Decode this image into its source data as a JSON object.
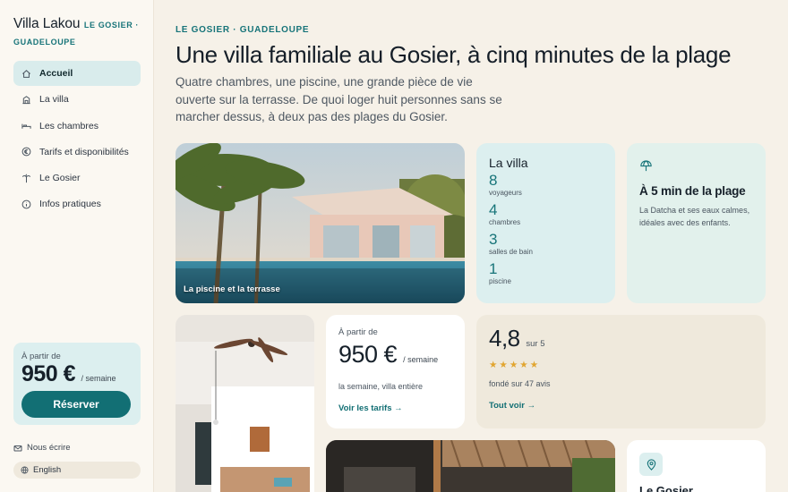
{
  "brand": {
    "name": "Villa Lakou",
    "location": "LE GOSIER · GUADELOUPE"
  },
  "nav": [
    {
      "label": "Accueil",
      "icon": "home-icon",
      "active": true
    },
    {
      "label": "La villa",
      "icon": "building-icon"
    },
    {
      "label": "Les chambres",
      "icon": "bed-icon"
    },
    {
      "label": "Tarifs et disponibilités",
      "icon": "euro-icon"
    },
    {
      "label": "Le Gosier",
      "icon": "palm-icon"
    },
    {
      "label": "Infos pratiques",
      "icon": "info-icon"
    }
  ],
  "booking": {
    "from_label": "À partir de",
    "price": "950 €",
    "unit": "/ semaine",
    "button": "Réserver"
  },
  "footer_links": {
    "contact": "Nous écrire",
    "language": "English"
  },
  "hero": {
    "kicker": "LE GOSIER · GUADELOUPE",
    "title": "Une villa familiale au Gosier, à cinq minutes de la plage",
    "lead": "Quatre chambres, une piscine, une grande pièce de vie ouverte sur la terrasse. De quoi loger huit personnes sans se marcher dessus, à deux pas des plages du Gosier."
  },
  "pool_photo": {
    "caption": "La piscine et la terrasse"
  },
  "stats": {
    "title": "La villa",
    "items": [
      {
        "value": "8",
        "label": "voyageurs"
      },
      {
        "value": "4",
        "label": "chambres"
      },
      {
        "value": "3",
        "label": "salles de bain"
      },
      {
        "value": "1",
        "label": "piscine"
      }
    ]
  },
  "beach": {
    "icon": "umbrella-icon",
    "title": "À 5 min de la plage",
    "text": "La Datcha et ses eaux calmes, idéales avec des enfants."
  },
  "price_card": {
    "from_label": "À partir de",
    "price": "950 €",
    "unit": "/ semaine",
    "note": "la semaine, villa entière",
    "link": "Voir les tarifs →"
  },
  "rating": {
    "score": "4,8",
    "out_of": "sur 5",
    "stars": 5,
    "note": "fondé sur 47 avis",
    "link": "Tout voir →"
  },
  "gosier_card": {
    "icon": "map-pin-icon",
    "title": "Le Gosier"
  },
  "colors": {
    "accent": "#126f74",
    "teal_light": "#dcefef",
    "background": "#f6f1e8",
    "star": "#e1a530"
  }
}
